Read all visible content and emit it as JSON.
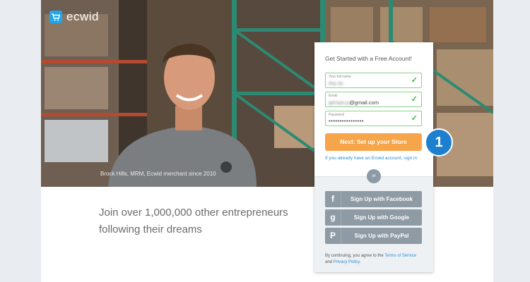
{
  "brand": {
    "name": "ecwid",
    "accent": "#1ea7e9",
    "icon": "cart-icon"
  },
  "hero": {
    "caption": "Brock Hills, MRM, Ecwid merchant since 2010"
  },
  "tagline": {
    "line1": "Join over 1,000,000 other entrepreneurs",
    "line2": "following their dreams"
  },
  "signup": {
    "title": "Get Started with a Free Account!",
    "fields": [
      {
        "label": "Your full name",
        "value": "Per Er"
      },
      {
        "label": "Email",
        "value_hidden": "person.p",
        "value_visible": "@gmail.com"
      },
      {
        "label": "Password",
        "value": "••••••••••••••••"
      }
    ],
    "next_button": "Next: Set up your Store",
    "signin_link": "If you already have an Ecwid account, sign in",
    "or_label": "or",
    "social": [
      {
        "icon": "facebook-icon",
        "glyph": "f",
        "label": "Sign Up with Facebook"
      },
      {
        "icon": "google-icon",
        "glyph": "g",
        "label": "Sign Up with Google"
      },
      {
        "icon": "paypal-icon",
        "glyph": "P",
        "label": "Sign Up with PayPal"
      }
    ],
    "terms_prefix": "By continuing, you agree to the ",
    "terms_link": "Terms of Service",
    "terms_and": " and ",
    "privacy_link": "Privacy Policy",
    "terms_suffix": "."
  },
  "step_badge": "1",
  "colors": {
    "next_button": "#f7a54a",
    "social_button": "#8e9aa4",
    "field_valid": "#39b54a",
    "link": "#2c8fd1",
    "step_badge": "#1d7fd0"
  }
}
